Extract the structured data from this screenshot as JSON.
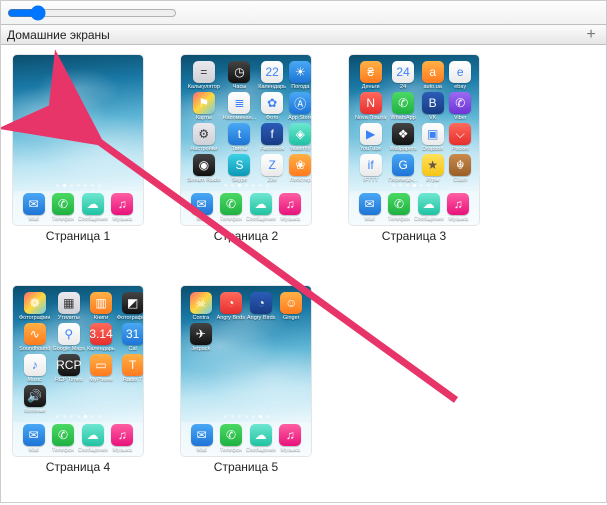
{
  "section_title": "Домашние экраны",
  "add_icon": "+",
  "slider_value": 15,
  "dock": [
    {
      "label": "Mail",
      "cls": "c-blue",
      "glyph": "✉"
    },
    {
      "label": "Телефон",
      "cls": "c-green",
      "glyph": "✆"
    },
    {
      "label": "Сообщения",
      "cls": "c-mint",
      "glyph": "☁"
    },
    {
      "label": "Музыка",
      "cls": "c-pink",
      "glyph": "♫"
    }
  ],
  "pages": [
    {
      "label": "Страница 1",
      "apps": []
    },
    {
      "label": "Страница 2",
      "apps": [
        {
          "label": "Калькулятор",
          "cls": "c-grey",
          "glyph": "="
        },
        {
          "label": "Часы",
          "cls": "c-black",
          "glyph": "◷"
        },
        {
          "label": "Календарь",
          "cls": "c-white",
          "glyph": "22"
        },
        {
          "label": "Погода",
          "cls": "c-blue",
          "glyph": "☀"
        },
        {
          "label": "Карты",
          "cls": "c-multi",
          "glyph": "⚑"
        },
        {
          "label": "Напоминан...",
          "cls": "c-white",
          "glyph": "≣"
        },
        {
          "label": "Фото",
          "cls": "c-white",
          "glyph": "✿"
        },
        {
          "label": "App Store",
          "cls": "c-blue",
          "glyph": "Ⓐ"
        },
        {
          "label": "Настройки",
          "cls": "c-grey",
          "glyph": "⚙"
        },
        {
          "label": "Твиты",
          "cls": "c-blue",
          "glyph": "t"
        },
        {
          "label": "Facebook",
          "cls": "c-dblue",
          "glyph": "f"
        },
        {
          "label": "Waterfly",
          "cls": "c-mint",
          "glyph": "◈"
        },
        {
          "label": "Stream Radio",
          "cls": "c-black",
          "glyph": "◉"
        },
        {
          "label": "Skype",
          "cls": "c-teal",
          "glyph": "S"
        },
        {
          "label": "Zite",
          "cls": "c-white",
          "glyph": "Z"
        },
        {
          "label": "Лобстер",
          "cls": "c-orange",
          "glyph": "❀"
        }
      ]
    },
    {
      "label": "Страница 3",
      "apps": [
        {
          "label": "Деньги",
          "cls": "c-orange",
          "glyph": "₴"
        },
        {
          "label": "24",
          "cls": "c-white",
          "glyph": "24"
        },
        {
          "label": "auto.ua",
          "cls": "c-orange",
          "glyph": "a"
        },
        {
          "label": "ebay",
          "cls": "c-white",
          "glyph": "e"
        },
        {
          "label": "Nova Пошта",
          "cls": "c-red",
          "glyph": "N"
        },
        {
          "label": "WhatsApp",
          "cls": "c-green",
          "glyph": "✆"
        },
        {
          "label": "VK",
          "cls": "c-dblue",
          "glyph": "В"
        },
        {
          "label": "Viber",
          "cls": "c-purple",
          "glyph": "✆"
        },
        {
          "label": "YouTube",
          "cls": "c-white",
          "glyph": "▶"
        },
        {
          "label": "Wallpapers",
          "cls": "c-black",
          "glyph": "❖"
        },
        {
          "label": "Dropbox",
          "cls": "c-white",
          "glyph": "▣"
        },
        {
          "label": "Pocket",
          "cls": "c-red",
          "glyph": "⌵"
        },
        {
          "label": "IFTTT",
          "cls": "c-white",
          "glyph": "if"
        },
        {
          "label": "Переводч...",
          "cls": "c-blue",
          "glyph": "G"
        },
        {
          "label": "Игры",
          "cls": "c-yellow",
          "glyph": "★"
        },
        {
          "label": "Clash",
          "cls": "c-brown",
          "glyph": "☬"
        }
      ]
    },
    {
      "label": "Страница 4",
      "apps": [
        {
          "label": "Фотографии",
          "cls": "c-multi",
          "glyph": "❁"
        },
        {
          "label": "Утилиты",
          "cls": "c-grey",
          "glyph": "▦"
        },
        {
          "label": "Книги",
          "cls": "c-orange",
          "glyph": "▥"
        },
        {
          "label": "Фотографии",
          "cls": "c-black",
          "glyph": "◩"
        },
        {
          "label": "Soundhound",
          "cls": "c-orange",
          "glyph": "∿"
        },
        {
          "label": "Google Maps",
          "cls": "c-white",
          "glyph": "⚲"
        },
        {
          "label": "Календарь",
          "cls": "c-red",
          "glyph": "3.14"
        },
        {
          "label": "Cal",
          "cls": "c-blue",
          "glyph": "31"
        },
        {
          "label": "Music",
          "cls": "c-white",
          "glyph": "♪"
        },
        {
          "label": "RCP Times",
          "cls": "c-black",
          "glyph": "RCP"
        },
        {
          "label": "MyPhone",
          "cls": "c-orange",
          "glyph": "▭"
        },
        {
          "label": "Radio T",
          "cls": "c-orange",
          "glyph": "T"
        },
        {
          "label": "Колонки",
          "cls": "c-black",
          "glyph": "🔊"
        }
      ]
    },
    {
      "label": "Страница 5",
      "apps": [
        {
          "label": "Contra",
          "cls": "c-multi",
          "glyph": "☠"
        },
        {
          "label": "Angry Birds",
          "cls": "c-red",
          "glyph": "◔"
        },
        {
          "label": "Angry Birds",
          "cls": "c-dblue",
          "glyph": "◔"
        },
        {
          "label": "Ginger",
          "cls": "c-orange",
          "glyph": "☺"
        },
        {
          "label": "Jetpack",
          "cls": "c-black",
          "glyph": "✈"
        }
      ]
    }
  ]
}
